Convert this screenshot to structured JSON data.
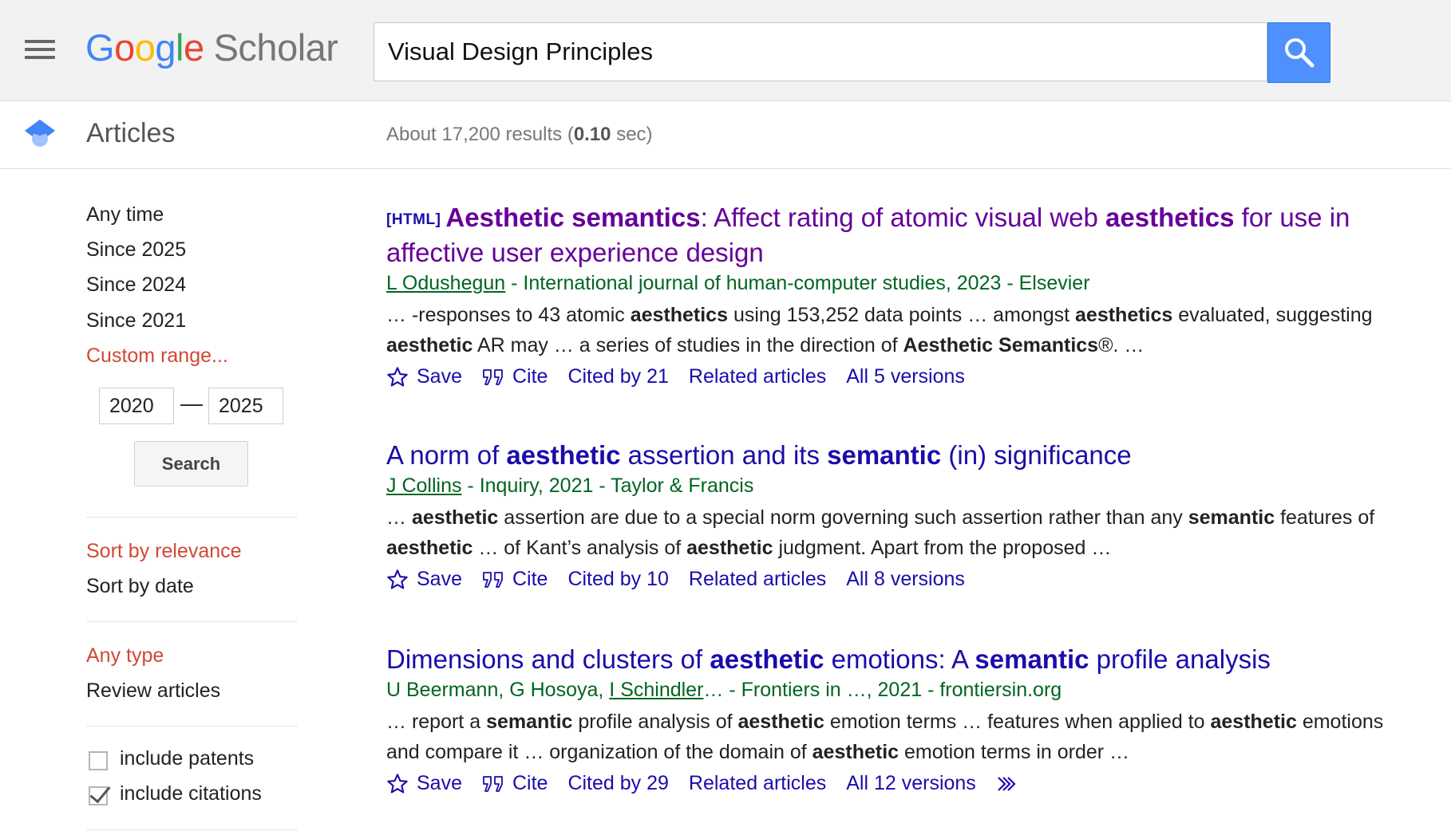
{
  "header": {
    "logo_google": [
      "G",
      "o",
      "o",
      "g",
      "l",
      "e"
    ],
    "logo_scholar": "Scholar",
    "search_query": "Visual Design Principles"
  },
  "subheader": {
    "section_label": "Articles",
    "stats_prefix": "About 17,200 results (",
    "stats_time": "0.10",
    "stats_suffix": " sec)"
  },
  "sidebar": {
    "time_filters": [
      "Any time",
      "Since 2025",
      "Since 2024",
      "Since 2021"
    ],
    "custom_range": "Custom range...",
    "range_from": "2020",
    "range_dash": "—",
    "range_to": "2025",
    "range_search": "Search",
    "sort_relevance": "Sort by relevance",
    "sort_date": "Sort by date",
    "type_any": "Any type",
    "type_review": "Review articles",
    "include_patents": "include patents",
    "include_citations": "include citations",
    "include_patents_checked": false,
    "include_citations_checked": true
  },
  "results": [
    {
      "tag": "[HTML]",
      "title_parts": [
        {
          "t": "Aesthetic semantics",
          "b": true
        },
        {
          "t": ": Affect rating of atomic visual web ",
          "b": false
        },
        {
          "t": "aesthetics",
          "b": true
        },
        {
          "t": " for use in affective user experience design",
          "b": false
        }
      ],
      "visited": true,
      "authors": "L Odushegun",
      "venue": " - International journal of human-computer studies, 2023 - Elsevier",
      "snippet_parts": [
        {
          "t": "… -responses to 43 atomic ",
          "b": false
        },
        {
          "t": "aesthetics",
          "b": true
        },
        {
          "t": " using 153,252 data points … amongst ",
          "b": false
        },
        {
          "t": "aesthetics",
          "b": true
        },
        {
          "t": " evaluated, suggesting ",
          "b": false
        },
        {
          "t": "aesthetic",
          "b": true
        },
        {
          "t": " AR may … a series of studies in the direction of ",
          "b": false
        },
        {
          "t": "Aesthetic Semantics",
          "b": true
        },
        {
          "t": "®. …",
          "b": false
        }
      ],
      "actions": {
        "save": "Save",
        "cite": "Cite",
        "cited_by": "Cited by 21",
        "related": "Related articles",
        "versions": "All 5 versions"
      }
    },
    {
      "tag": "",
      "title_parts": [
        {
          "t": "A norm of ",
          "b": false
        },
        {
          "t": "aesthetic",
          "b": true
        },
        {
          "t": " assertion and its ",
          "b": false
        },
        {
          "t": "semantic",
          "b": true
        },
        {
          "t": " (in) significance",
          "b": false
        }
      ],
      "visited": false,
      "authors": "J Collins",
      "venue": " - Inquiry, 2021 - Taylor & Francis",
      "snippet_parts": [
        {
          "t": "… ",
          "b": false
        },
        {
          "t": "aesthetic",
          "b": true
        },
        {
          "t": " assertion are due to a special norm governing such assertion rather than any ",
          "b": false
        },
        {
          "t": "semantic",
          "b": true
        },
        {
          "t": " features of ",
          "b": false
        },
        {
          "t": "aesthetic",
          "b": true
        },
        {
          "t": " … of Kant’s analysis of ",
          "b": false
        },
        {
          "t": "aesthetic",
          "b": true
        },
        {
          "t": " judgment. Apart from the proposed …",
          "b": false
        }
      ],
      "actions": {
        "save": "Save",
        "cite": "Cite",
        "cited_by": "Cited by 10",
        "related": "Related articles",
        "versions": "All 8 versions"
      }
    },
    {
      "tag": "",
      "title_parts": [
        {
          "t": "Dimensions and clusters of ",
          "b": false
        },
        {
          "t": "aesthetic",
          "b": true
        },
        {
          "t": " emotions: A ",
          "b": false
        },
        {
          "t": "semantic",
          "b": true
        },
        {
          "t": " profile analysis",
          "b": false
        }
      ],
      "visited": false,
      "authors_plain": "U Beermann, G Hosoya, ",
      "authors": "I Schindler",
      "venue": "… - Frontiers in …, 2021 - frontiersin.org",
      "snippet_parts": [
        {
          "t": "… report a ",
          "b": false
        },
        {
          "t": "semantic",
          "b": true
        },
        {
          "t": " profile analysis of ",
          "b": false
        },
        {
          "t": "aesthetic",
          "b": true
        },
        {
          "t": " emotion terms … features when applied to ",
          "b": false
        },
        {
          "t": "aesthetic",
          "b": true
        },
        {
          "t": " emotions and compare it … organization of the domain of ",
          "b": false
        },
        {
          "t": "aesthetic",
          "b": true
        },
        {
          "t": " emotion terms in order …",
          "b": false
        }
      ],
      "actions": {
        "save": "Save",
        "cite": "Cite",
        "cited_by": "Cited by 29",
        "related": "Related articles",
        "versions": "All 12 versions"
      },
      "has_more": true
    }
  ],
  "icons": {
    "menu": "hamburger-menu-icon",
    "search": "magnifier-icon",
    "articles": "graduation-cap-icon",
    "save": "star-outline-icon",
    "cite": "quotation-mark-icon",
    "more": "double-chevron-right-icon"
  },
  "colors": {
    "link": "#1a0dab",
    "visited": "#660099",
    "meta_green": "#006621",
    "active_red": "#d14836",
    "search_blue": "#4d90fe"
  }
}
